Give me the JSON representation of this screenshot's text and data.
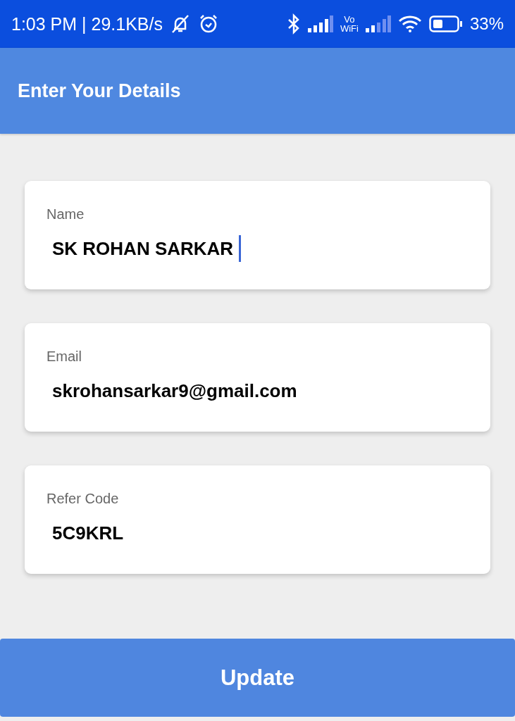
{
  "status_bar": {
    "time_speed": "1:03 PM | 29.1KB/s",
    "volte": "Vo",
    "volte_sub": "WiFi",
    "battery": "33%"
  },
  "app_bar": {
    "title": "Enter Your Details"
  },
  "fields": [
    {
      "label": "Name",
      "value": "SK ROHAN SARKAR",
      "focused": true
    },
    {
      "label": "Email",
      "value": "skrohansarkar9@gmail.com",
      "focused": false
    },
    {
      "label": "Refer Code",
      "value": "5C9KRL",
      "focused": false
    }
  ],
  "button": {
    "label": "Update"
  }
}
